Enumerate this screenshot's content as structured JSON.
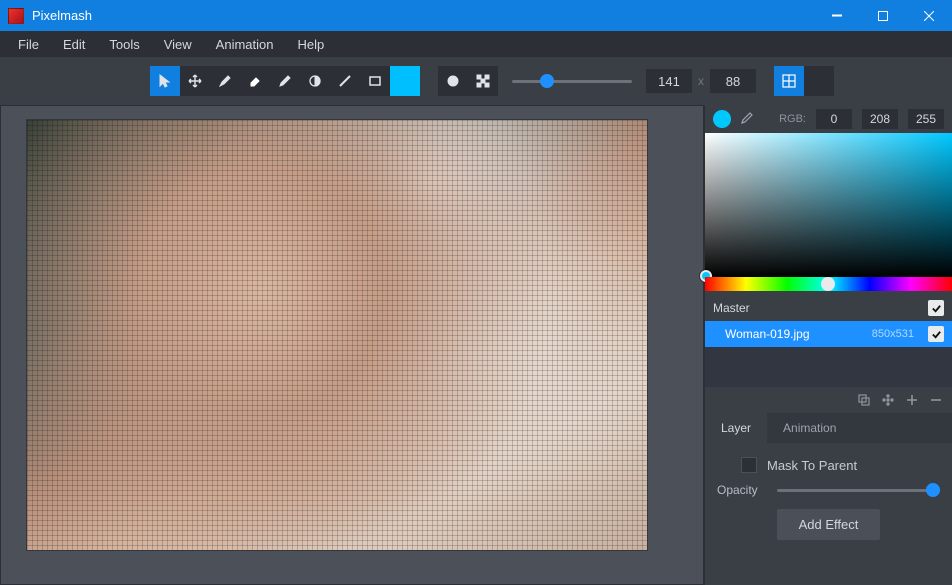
{
  "titlebar": {
    "title": "Pixelmash"
  },
  "menu": [
    "File",
    "Edit",
    "Tools",
    "View",
    "Animation",
    "Help"
  ],
  "toolbar": {
    "dims": {
      "w": "141",
      "x": "x",
      "h": "88"
    }
  },
  "color": {
    "rgb_label": "RGB:",
    "r": "0",
    "g": "208",
    "b": "255"
  },
  "layers": {
    "master_label": "Master",
    "item": {
      "name": "Woman-019.jpg",
      "dims": "850x531"
    }
  },
  "tabs": {
    "layer": "Layer",
    "animation": "Animation"
  },
  "options": {
    "mask_label": "Mask To Parent",
    "opacity_label": "Opacity",
    "add_effect": "Add Effect"
  }
}
